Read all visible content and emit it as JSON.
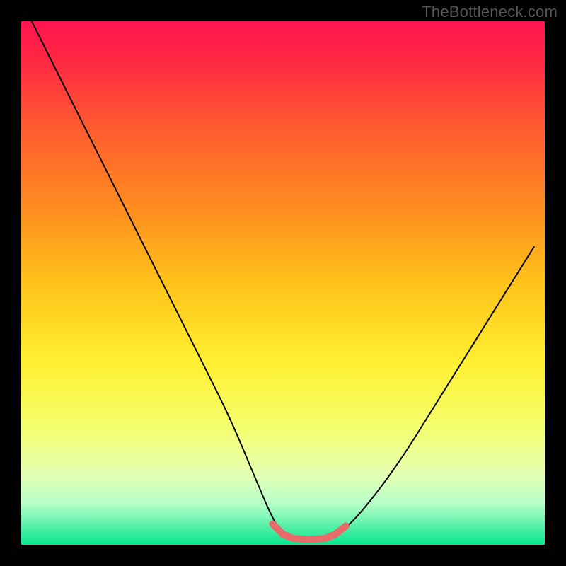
{
  "watermark": "TheBottleneck.com",
  "chart_data": {
    "type": "line",
    "title": "",
    "xlabel": "",
    "ylabel": "",
    "xlim": [
      0,
      100
    ],
    "ylim": [
      0,
      100
    ],
    "background_gradient": {
      "stops": [
        {
          "offset": 0.0,
          "color": "#ff1450"
        },
        {
          "offset": 0.08,
          "color": "#ff2a42"
        },
        {
          "offset": 0.2,
          "color": "#ff5a30"
        },
        {
          "offset": 0.35,
          "color": "#ff8a20"
        },
        {
          "offset": 0.5,
          "color": "#ffc21a"
        },
        {
          "offset": 0.65,
          "color": "#fff030"
        },
        {
          "offset": 0.78,
          "color": "#f4ff70"
        },
        {
          "offset": 0.86,
          "color": "#e6ffb0"
        },
        {
          "offset": 0.92,
          "color": "#b8ffc8"
        },
        {
          "offset": 1.0,
          "color": "#06e58e"
        }
      ]
    },
    "series": [
      {
        "name": "curve",
        "color": "#000000",
        "x": [
          2,
          5,
          10,
          15,
          20,
          25,
          30,
          35,
          40,
          45,
          48,
          50,
          52,
          55,
          58,
          60,
          63,
          68,
          73,
          78,
          83,
          88,
          93,
          98
        ],
        "y": [
          100,
          94,
          84,
          74,
          64,
          54,
          44,
          34,
          24,
          12,
          5,
          2,
          1,
          1,
          1,
          2,
          4,
          10,
          17,
          25,
          33,
          41,
          49,
          57
        ]
      },
      {
        "name": "highlight-segment",
        "color": "#e86a6a",
        "thick": true,
        "x": [
          48,
          50,
          52,
          55,
          58,
          60,
          62
        ],
        "y": [
          4,
          2,
          1.2,
          1,
          1.2,
          2,
          3.6
        ]
      }
    ]
  }
}
